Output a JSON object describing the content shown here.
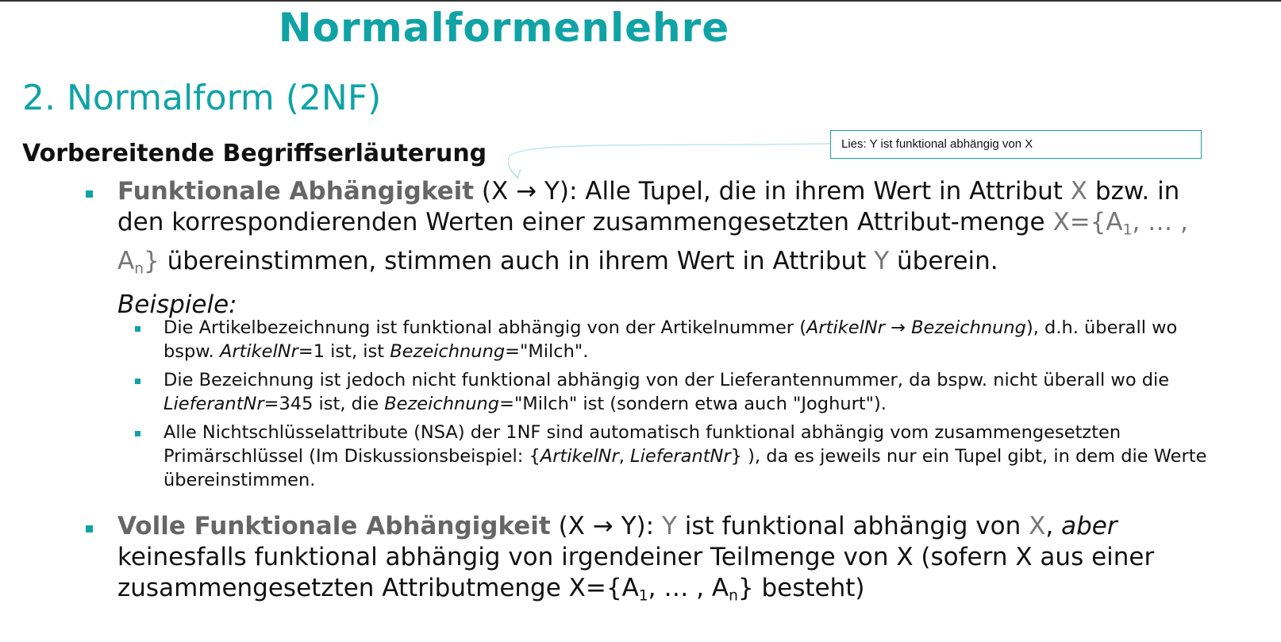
{
  "title": "Normalformenlehre",
  "subtitle": "2. Normalform (2NF)",
  "section_heading": "Vorbereitende Begriffserläuterung",
  "callout_text": "Lies: Y ist funktional abhängig von X",
  "def1": {
    "term": "Funktionale Abhängigkeit",
    "t1": " (X → Y): Alle Tupel, die in ihrem Wert in Attribut ",
    "x": "X",
    "t2": " bzw. in den korrespondierenden Werten einer zusammengesetzten Attribut-menge ",
    "xset_open": "X={A",
    "sub1": "1",
    "xset_mid": ", … , A",
    "subn": "n",
    "xset_close": "}",
    "t3": " übereinstimmen, stimmen auch in ihrem Wert in Attribut ",
    "y": "Y",
    "t4": " überein."
  },
  "examples_label": "Beispiele:",
  "ex1": {
    "a": "Die Artikelbezeichnung ist funktional abhängig von der Artikelnummer (",
    "i1": "ArtikelNr",
    "arrow": " → ",
    "i2": "Bezeichnung",
    "b": "), d.h. überall wo bspw. ",
    "i3": "ArtikelNr",
    "c": "=1 ist, ist ",
    "i4": "Bezeichnung",
    "d": "=\"Milch\"."
  },
  "ex2": {
    "a": "Die Bezeichnung ist jedoch nicht funktional abhängig von der Lieferantennummer, da bspw. nicht überall wo die ",
    "i1": "LieferantNr",
    "b": "=345 ist, die ",
    "i2": "Bezeichnung",
    "c": "=\"Milch\" ist (sondern etwa auch \"Joghurt\")."
  },
  "ex3": {
    "a": "Alle Nichtschlüsselattribute (NSA) der 1NF sind automatisch funktional abhängig vom zusammengesetzten Primärschlüssel (Im Diskussionsbeispiel: {",
    "i1": "ArtikelNr",
    "sep": ", ",
    "i2": "LieferantNr",
    "b": "} ), da es jeweils nur ein Tupel gibt, in dem die Werte übereinstimmen."
  },
  "def2": {
    "term": "Volle Funktionale Abhängigkeit",
    "t1": " (X → Y): ",
    "y": "Y",
    "t2": " ist funktional abhängig von ",
    "x": "X",
    "t3": ", ",
    "aber": "aber",
    "t4": " keinesfalls funktional abhängig von irgendeiner Teilmenge von X (sofern X aus einer zusammengesetzten Attributmenge X={A",
    "sub1": "1",
    "t5": ", … , A",
    "subn": "n",
    "t6": "} besteht)"
  },
  "colors": {
    "accent": "#10a3a6",
    "term_gray": "#666666",
    "var_gray": "#777777"
  }
}
